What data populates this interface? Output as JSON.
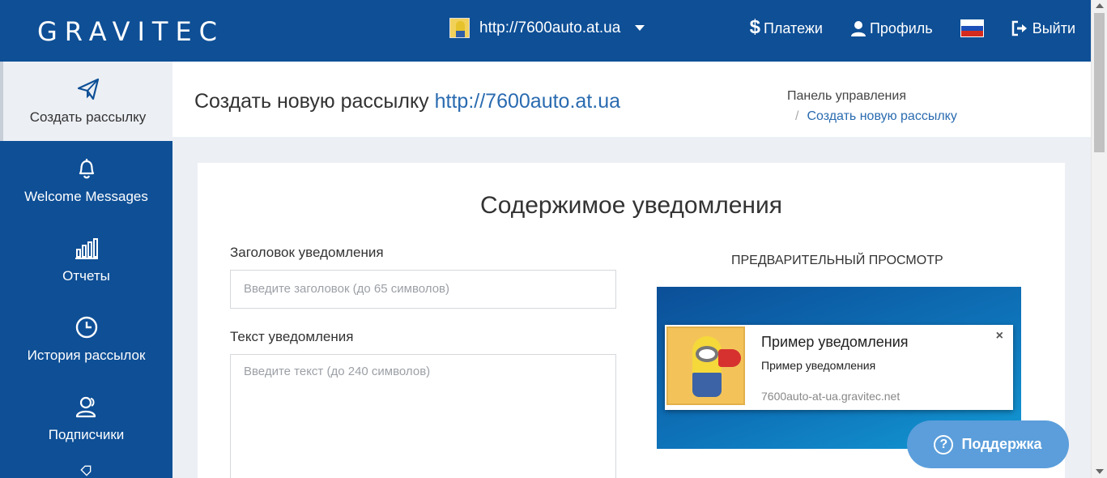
{
  "topbar": {
    "logo": "GRAVITEC",
    "site_url": "http://7600auto.at.ua",
    "payments": "Платежи",
    "profile": "Профиль",
    "logout": "Выйти",
    "flag_colors": [
      "#ffffff",
      "#1c4fb8",
      "#d52b1e"
    ]
  },
  "sidebar": {
    "items": [
      {
        "label": "Создать рассылку",
        "icon": "paper-plane-icon",
        "active": true
      },
      {
        "label": "Welcome Messages",
        "icon": "bell-icon"
      },
      {
        "label": "Отчеты",
        "icon": "bar-chart-icon"
      },
      {
        "label": "История рассылок",
        "icon": "clock-icon"
      },
      {
        "label": "Подписчики",
        "icon": "users-icon"
      }
    ]
  },
  "header": {
    "title": "Создать новую рассылку",
    "title_link": "http://7600auto.at.ua",
    "breadcrumb_root": "Панель управления",
    "breadcrumb_sep": "/",
    "breadcrumb_current": "Создать новую рассылку"
  },
  "form": {
    "section_title": "Содержимое уведомления",
    "title_label": "Заголовок уведомления",
    "title_placeholder": "Введите заголовок (до 65 символов)",
    "text_label": "Текст уведомления",
    "text_placeholder": "Введите текст (до 240 символов)"
  },
  "preview": {
    "label": "ПРЕДВАРИТЕЛЬНЫЙ ПРОСМОТР",
    "notif_title": "Пример уведомления",
    "notif_body": "Пример уведомления",
    "notif_domain": "7600auto-at-ua.gravitec.net",
    "close": "×"
  },
  "support": {
    "label": "Поддержка",
    "q": "?"
  },
  "colors": {
    "brand": "#0e4f96",
    "link": "#2a6bb0",
    "support": "#5b9edb"
  }
}
